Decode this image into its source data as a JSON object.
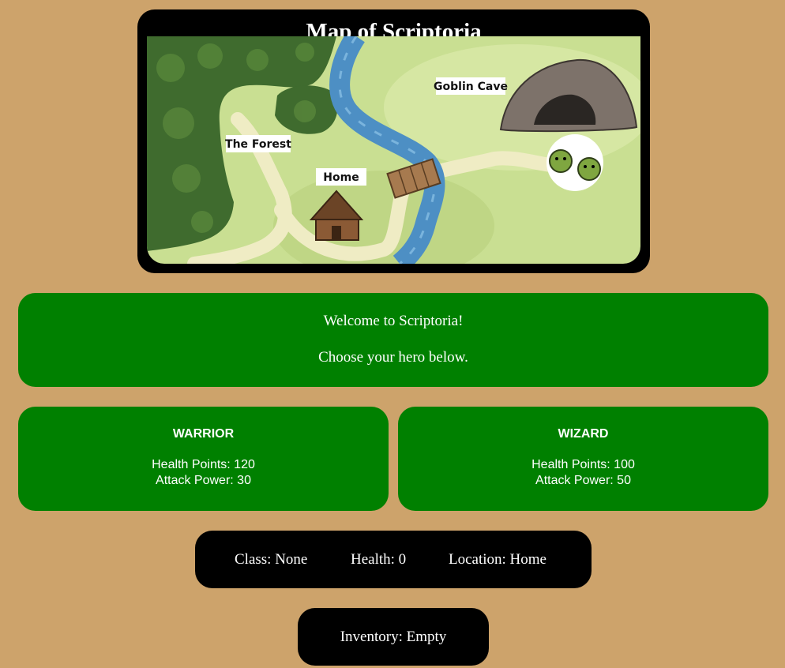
{
  "map": {
    "title": "Map of Scriptoria",
    "locations": {
      "forest": "The Forest",
      "home": "Home",
      "cave": "Goblin Cave"
    }
  },
  "welcome": {
    "line1": "Welcome to Scriptoria!",
    "line2": "Choose your hero below."
  },
  "heroes": [
    {
      "name": "WARRIOR",
      "health_label": "Health Points: 120",
      "attack_label": "Attack Power: 30"
    },
    {
      "name": "WIZARD",
      "health_label": "Health Points: 100",
      "attack_label": "Attack Power: 50"
    }
  ],
  "status": {
    "class_text": "Class: None",
    "health_text": "Health: 0",
    "location_text": "Location: Home"
  },
  "inventory": {
    "text": "Inventory: Empty"
  },
  "colors": {
    "background": "#cda36b",
    "panel_green": "#008000",
    "panel_black": "#000000",
    "river": "#4d8fc4",
    "grass": "#c5dc8c",
    "forest": "#3f6b2e"
  }
}
